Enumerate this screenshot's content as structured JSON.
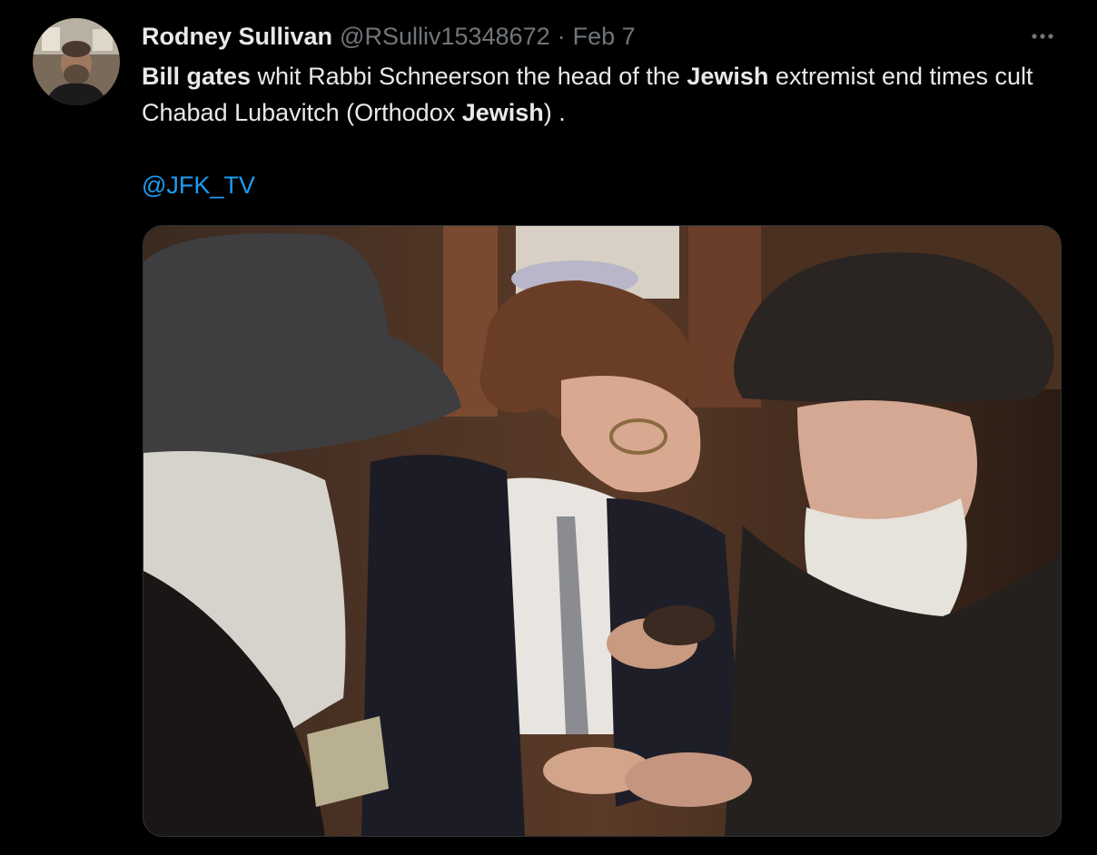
{
  "tweet": {
    "author": {
      "display_name": "Rodney Sullivan",
      "handle": "@RSulliv15348672"
    },
    "separator": "·",
    "timestamp": "Feb 7",
    "more_icon": "more-horizontal-icon",
    "text": {
      "p1": "Bill gates",
      "p2": " whit Rabbi Schneerson the head of the ",
      "p3": "Jewish",
      "p4": " extremist end times cult Chabad Lubavitch (Orthodox ",
      "p5": "Jewish",
      "p6": ") ."
    },
    "mention": "@JFK_TV"
  },
  "colors": {
    "background": "#000000",
    "primary_text": "#e7e9ea",
    "secondary_text": "#71767b",
    "link": "#1d9bf0",
    "media_border": "#2f3336"
  }
}
